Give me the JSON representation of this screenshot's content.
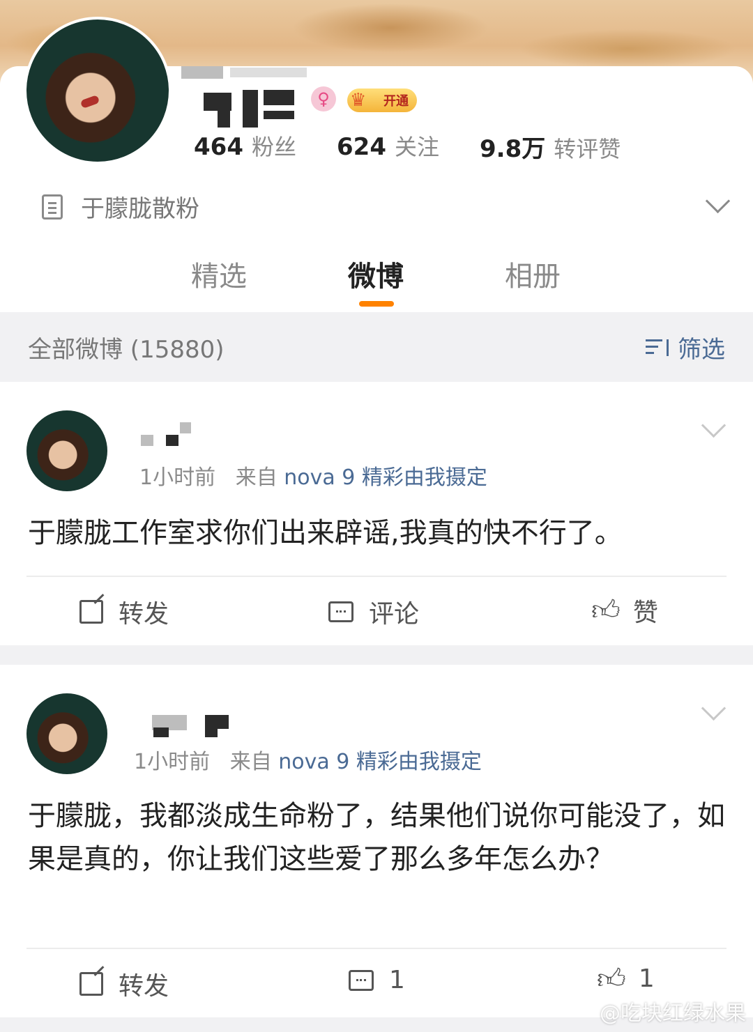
{
  "profile": {
    "stats": [
      {
        "num": "464",
        "label": "粉丝"
      },
      {
        "num": "624",
        "label": "关注"
      },
      {
        "num": "9.8万",
        "label": "转评赞"
      }
    ],
    "vip_label": "开通",
    "gender_icon": "female-icon",
    "intro": "于朦胧散粉"
  },
  "tabs": [
    {
      "label": "精选",
      "active": false
    },
    {
      "label": "微博",
      "active": true
    },
    {
      "label": "相册",
      "active": false
    }
  ],
  "filter_bar": {
    "all_label": "全部微博 (15880)",
    "filter_label": "筛选"
  },
  "posts": [
    {
      "time": "1小时前",
      "from_prefix": "来自",
      "source": "nova 9 精彩由我摄定",
      "text": "于朦胧工作室求你们出来辟谣,我真的快不行了。",
      "repost_label": "转发",
      "comment_label": "评论",
      "like_label": "赞"
    },
    {
      "time": "1小时前",
      "from_prefix": "来自",
      "source": "nova 9 精彩由我摄定",
      "text": "于朦胧，我都淡成生命粉了，结果他们说你可能没了，如果是真的，你让我们这些爱了那么多年怎么办？",
      "repost_label": "转发",
      "comment_label": "1",
      "like_label": "1"
    }
  ],
  "watermark": "@吃块红绿水果",
  "colors": {
    "accent": "#ff8200",
    "link": "#4a6a94",
    "muted": "#8a8a8a"
  }
}
